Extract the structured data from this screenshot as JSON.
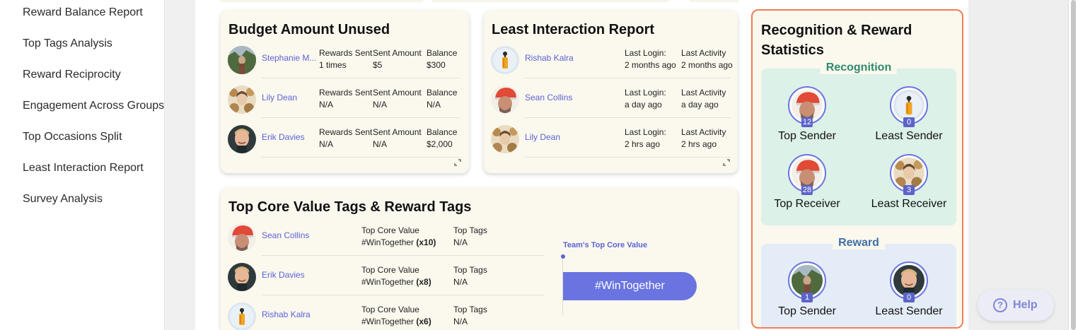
{
  "sidebar": {
    "items": [
      {
        "label": "Reward Balance Report"
      },
      {
        "label": "Top Tags Analysis"
      },
      {
        "label": "Reward Reciprocity"
      },
      {
        "label": "Engagement Across Groups"
      },
      {
        "label": "Top Occasions Split"
      },
      {
        "label": "Least Interaction Report"
      },
      {
        "label": "Survey Analysis"
      }
    ]
  },
  "budget": {
    "title": "Budget Amount Unused",
    "rows": [
      {
        "name": "Stephanie M...",
        "c1_h": "Rewards Sent",
        "c1_v": "1 times",
        "c2_h": "Sent Amount",
        "c2_v": "$5",
        "c3_h": "Balance",
        "c3_v": "$300",
        "avatar": "stephanie"
      },
      {
        "name": "Lily Dean",
        "c1_h": "Rewards Sent",
        "c1_v": "N/A",
        "c2_h": "Sent Amount",
        "c2_v": "N/A",
        "c3_h": "Balance",
        "c3_v": "N/A",
        "avatar": "lily"
      },
      {
        "name": "Erik Davies",
        "c1_h": "Rewards Sent",
        "c1_v": "N/A",
        "c2_h": "Sent Amount",
        "c2_v": "N/A",
        "c3_h": "Balance",
        "c3_v": "$2,000",
        "avatar": "erik"
      }
    ]
  },
  "least": {
    "title": "Least Interaction Report",
    "rows": [
      {
        "name": "Rishab Kalra",
        "c1_h": "Last Login:",
        "c1_v": "2 months ago",
        "c2_h": "Last Activity",
        "c2_v": "2 months ago",
        "avatar": "rishab"
      },
      {
        "name": "Sean Collins",
        "c1_h": "Last Login:",
        "c1_v": "a day ago",
        "c2_h": "Last Activity",
        "c2_v": "a day ago",
        "avatar": "sean"
      },
      {
        "name": "Lily Dean",
        "c1_h": "Last Login:",
        "c1_v": "2 hrs ago",
        "c2_h": "Last Activity",
        "c2_v": "2 hrs ago",
        "avatar": "lily"
      }
    ]
  },
  "tags": {
    "title": "Top Core Value Tags & Reward Tags",
    "team_label": "Team's Top Core Value",
    "team_value": "#WinTogether",
    "rows": [
      {
        "name": "Sean Collins",
        "cv_h": "Top Core Value",
        "cv_tag": "#WinTogether",
        "cv_count": "(x10)",
        "tt_h": "Top Tags",
        "tt_v": "N/A",
        "avatar": "sean"
      },
      {
        "name": "Erik Davies",
        "cv_h": "Top Core Value",
        "cv_tag": "#WinTogether",
        "cv_count": "(x8)",
        "tt_h": "Top Tags",
        "tt_v": "N/A",
        "avatar": "erik"
      },
      {
        "name": "Rishab Kalra",
        "cv_h": "Top Core Value",
        "cv_tag": "#WinTogether",
        "cv_count": "(x6)",
        "tt_h": "Top Tags",
        "tt_v": "N/A",
        "avatar": "rishab"
      }
    ]
  },
  "stats": {
    "title_line1": "Recognition & Reward",
    "title_line2": "Statistics",
    "recognition": {
      "label": "Recognition",
      "items": [
        {
          "label": "Top Sender",
          "count": "12",
          "avatar": "sean"
        },
        {
          "label": "Least Sender",
          "count": "0",
          "avatar": "rishab"
        },
        {
          "label": "Top Receiver",
          "count": "28",
          "avatar": "sean"
        },
        {
          "label": "Least Receiver",
          "count": "3",
          "avatar": "lily"
        }
      ]
    },
    "reward": {
      "label": "Reward",
      "items": [
        {
          "label": "Top Sender",
          "count": "1",
          "avatar": "stephanie"
        },
        {
          "label": "Least Sender",
          "count": "0",
          "avatar": "erik"
        }
      ]
    }
  },
  "help": {
    "label": "Help",
    "icon": "question-icon"
  },
  "colors": {
    "accent": "#6a74e0",
    "link": "#5a63d6",
    "card_bg": "#fbf8ee",
    "highlight_border": "#ef7d57",
    "recognition_bg": "#dcf1e8",
    "recognition_text": "#2e8a6e",
    "reward_bg": "#e4ecf7",
    "reward_text": "#3f6fa8"
  }
}
